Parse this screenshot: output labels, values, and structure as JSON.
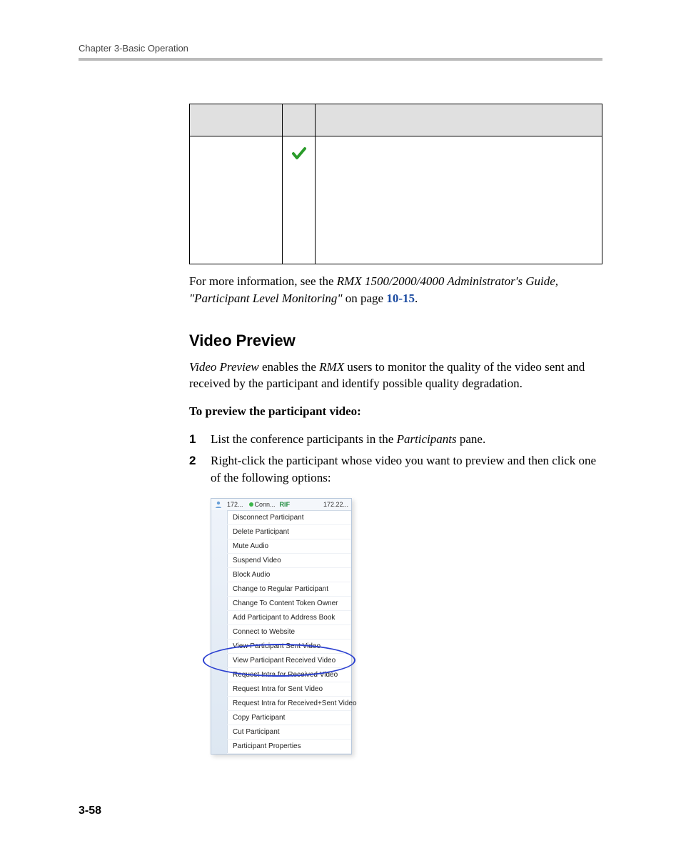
{
  "header": {
    "chapter": "Chapter 3-Basic Operation"
  },
  "table_note": {
    "lead": "For more information, see the ",
    "ref_italic": "RMX 1500/2000/4000 Administrator's Guide, \"Participant Level Monitoring\"",
    "onpage": " on page ",
    "pageref": "10-15",
    "period": "."
  },
  "section": {
    "title": "Video Preview"
  },
  "intro": {
    "term": "Video Preview",
    "mid": " enables the ",
    "rmx": "RMX",
    "rest": " users to monitor the quality of the video sent and received by the participant and identify possible quality degradation."
  },
  "procedure": {
    "title": "To preview the participant video:",
    "steps": [
      {
        "num": "1",
        "pre": "List the conference participants in the ",
        "ital": "Participants",
        "post": " pane."
      },
      {
        "num": "2",
        "pre": "Right-click the participant whose video you want to preview and then click one of the following options:",
        "ital": "",
        "post": ""
      }
    ]
  },
  "menu": {
    "row": {
      "ip1": "172...",
      "status": "Conn...",
      "ip2": "172.22..."
    },
    "items": [
      "Disconnect Participant",
      "Delete Participant",
      "Mute Audio",
      "Suspend Video",
      "Block Audio",
      "Change to Regular Participant",
      "Change To Content Token Owner",
      "Add Participant to Address Book",
      "Connect to Website",
      "View Participant Sent Video",
      "View Participant Received Video",
      "Request Intra for Received Video",
      "Request Intra for Sent Video",
      "Request Intra for Received+Sent Video",
      "Copy Participant",
      "Cut Participant",
      "Participant Properties"
    ]
  },
  "footer": {
    "page": "3-58"
  }
}
